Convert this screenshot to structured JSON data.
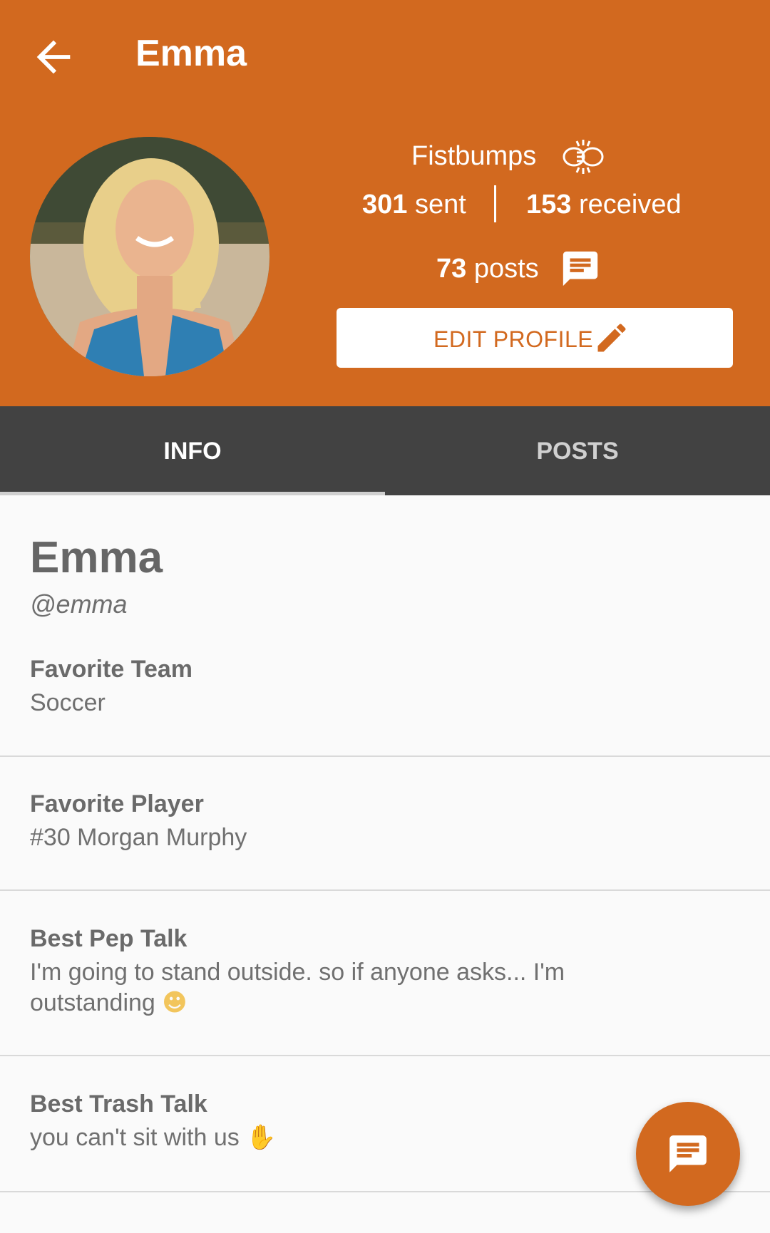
{
  "toolbar": {
    "title": "Emma",
    "back_icon": "arrow-back-icon"
  },
  "profile": {
    "avatar_icon": "profile-photo",
    "fistbumps_label": "Fistbumps",
    "sent_count": "301",
    "sent_label": " sent",
    "received_count": "153",
    "received_label": " received",
    "posts_count": "73",
    "posts_label": " posts",
    "edit_label": "EDIT PROFILE"
  },
  "tabs": [
    {
      "label": "INFO",
      "active": true
    },
    {
      "label": "POSTS",
      "active": false
    }
  ],
  "info": {
    "name": "Emma",
    "handle": "@emma",
    "fields": [
      {
        "label": "Favorite Team",
        "value": "Soccer"
      },
      {
        "label": "Favorite Player",
        "value": "#30 Morgan Murphy"
      },
      {
        "label": "Best Pep Talk",
        "value": "I'm going to stand outside. so if anyone asks... I'm outstanding"
      },
      {
        "label": "Best Trash Talk",
        "value": "you can't sit with us"
      }
    ]
  },
  "colors": {
    "accent": "#d2691f",
    "tabbar": "#424242",
    "background": "#fafafa"
  }
}
